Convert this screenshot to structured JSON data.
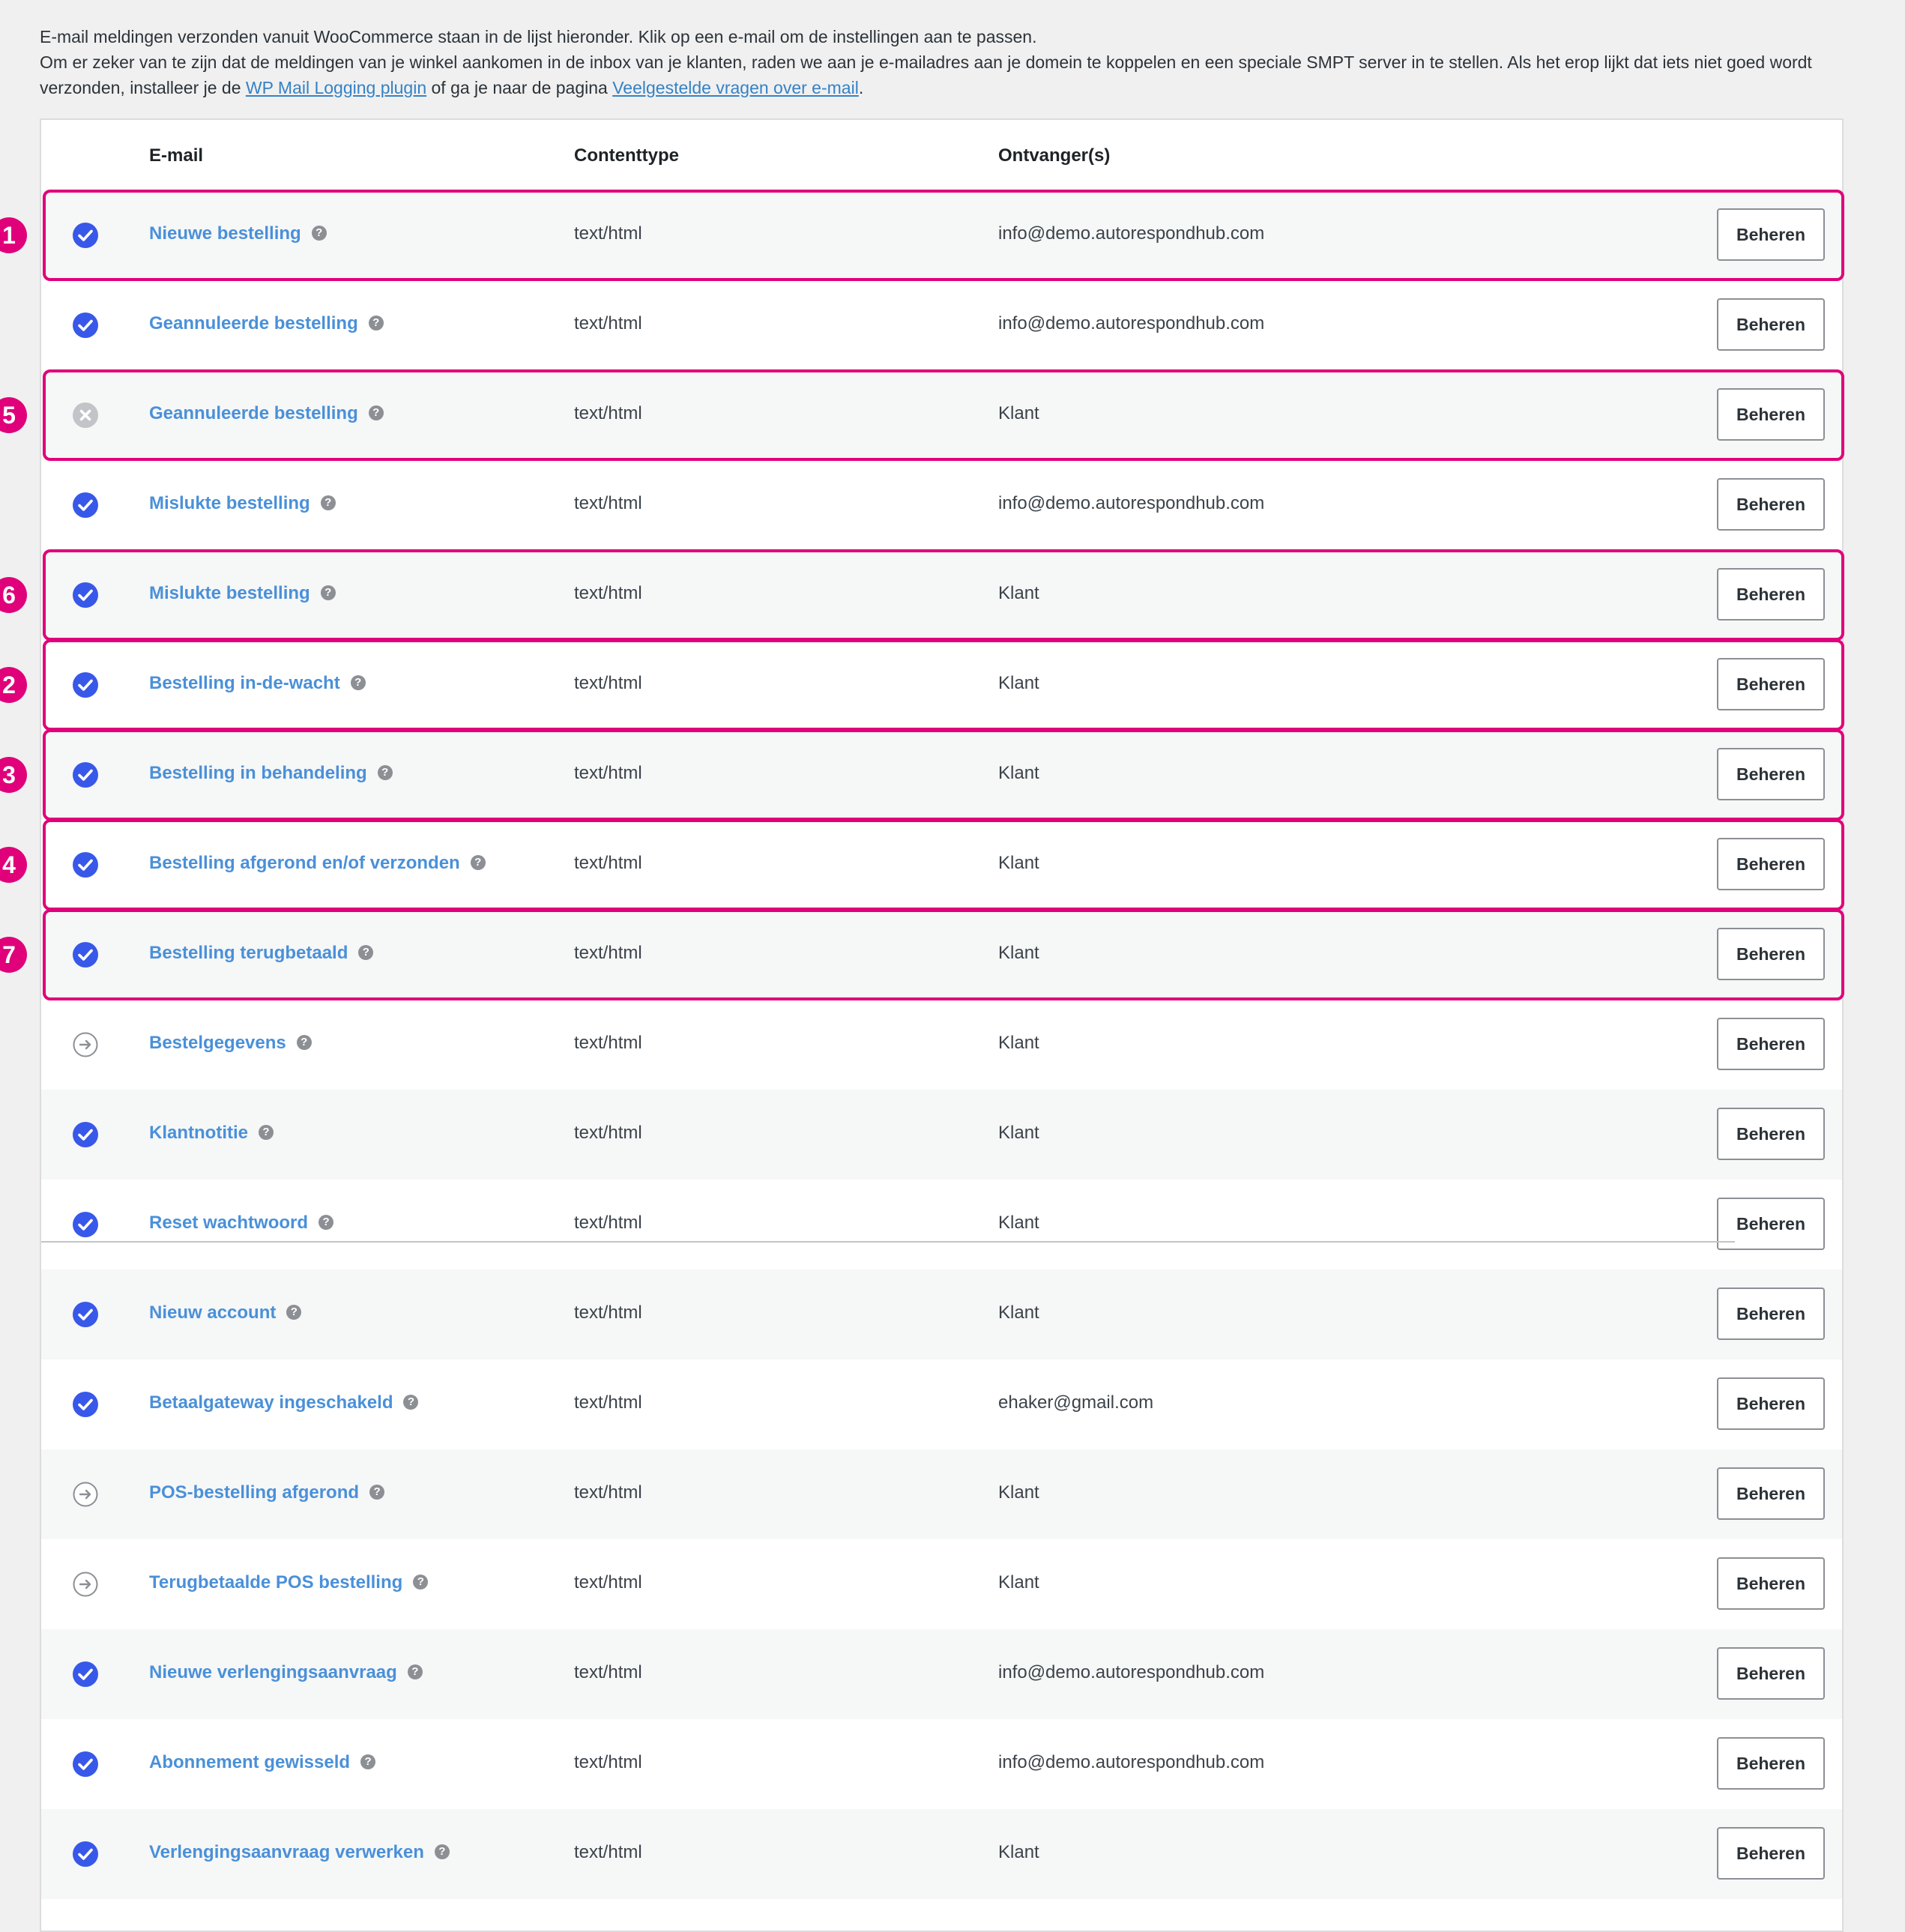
{
  "intro": {
    "line1": "E-mail meldingen verzonden vanuit WooCommerce staan in de lijst hieronder. Klik op een e-mail om de instellingen aan te passen.",
    "line2_pre": "Om er zeker van te zijn dat de meldingen van je winkel aankomen in de inbox van je klanten, raden we aan je e-mailadres aan je domein te koppelen en een speciale SMPT server in te stellen. Als het erop lijkt dat iets niet goed wordt verzonden, installeer je de ",
    "link1": "WP Mail Logging plugin",
    "line2_mid": " of ga je naar de pagina ",
    "link2": "Veelgestelde vragen over e-mail",
    "line2_end": "."
  },
  "table": {
    "headers": {
      "email": "E-mail",
      "content_type": "Contenttype",
      "recipients": "Ontvanger(s)"
    },
    "rows": [
      {
        "status": "enabled",
        "name": "Nieuwe bestelling",
        "content_type": "text/html",
        "recipient": "info@demo.autorespondhub.com",
        "action": "Beheren"
      },
      {
        "status": "enabled",
        "name": "Geannuleerde bestelling",
        "content_type": "text/html",
        "recipient": "info@demo.autorespondhub.com",
        "action": "Beheren"
      },
      {
        "status": "disabled",
        "name": "Geannuleerde bestelling",
        "content_type": "text/html",
        "recipient": "Klant",
        "action": "Beheren"
      },
      {
        "status": "enabled",
        "name": "Mislukte bestelling",
        "content_type": "text/html",
        "recipient": "info@demo.autorespondhub.com",
        "action": "Beheren"
      },
      {
        "status": "enabled",
        "name": "Mislukte bestelling",
        "content_type": "text/html",
        "recipient": "Klant",
        "action": "Beheren"
      },
      {
        "status": "enabled",
        "name": "Bestelling in-de-wacht",
        "content_type": "text/html",
        "recipient": "Klant",
        "action": "Beheren"
      },
      {
        "status": "enabled",
        "name": "Bestelling in behandeling",
        "content_type": "text/html",
        "recipient": "Klant",
        "action": "Beheren"
      },
      {
        "status": "enabled",
        "name": "Bestelling afgerond en/of verzonden",
        "content_type": "text/html",
        "recipient": "Klant",
        "action": "Beheren"
      },
      {
        "status": "enabled",
        "name": "Bestelling terugbetaald",
        "content_type": "text/html",
        "recipient": "Klant",
        "action": "Beheren"
      },
      {
        "status": "manual",
        "name": "Bestelgegevens",
        "content_type": "text/html",
        "recipient": "Klant",
        "action": "Beheren"
      },
      {
        "status": "enabled",
        "name": "Klantnotitie",
        "content_type": "text/html",
        "recipient": "Klant",
        "action": "Beheren"
      },
      {
        "status": "enabled",
        "name": "Reset wachtwoord",
        "content_type": "text/html",
        "recipient": "Klant",
        "action": "Beheren"
      },
      {
        "status": "enabled",
        "name": "Nieuw account",
        "content_type": "text/html",
        "recipient": "Klant",
        "action": "Beheren"
      },
      {
        "status": "enabled",
        "name": "Betaalgateway ingeschakeld",
        "content_type": "text/html",
        "recipient": "ehaker@gmail.com",
        "action": "Beheren"
      },
      {
        "status": "manual",
        "name": "POS-bestelling afgerond",
        "content_type": "text/html",
        "recipient": "Klant",
        "action": "Beheren"
      },
      {
        "status": "manual",
        "name": "Terugbetaalde POS bestelling",
        "content_type": "text/html",
        "recipient": "Klant",
        "action": "Beheren"
      },
      {
        "status": "enabled",
        "name": "Nieuwe verlengingsaanvraag",
        "content_type": "text/html",
        "recipient": "info@demo.autorespondhub.com",
        "action": "Beheren"
      },
      {
        "status": "enabled",
        "name": "Abonnement gewisseld",
        "content_type": "text/html",
        "recipient": "info@demo.autorespondhub.com",
        "action": "Beheren"
      },
      {
        "status": "enabled",
        "name": "Verlengingsaanvraag verwerken",
        "content_type": "text/html",
        "recipient": "Klant",
        "action": "Beheren"
      }
    ]
  },
  "highlights": [
    {
      "row": 0,
      "label": "1"
    },
    {
      "row": 2,
      "label": "5"
    },
    {
      "row": 4,
      "label": "6"
    },
    {
      "row": 5,
      "label": "2"
    },
    {
      "row": 6,
      "label": "3"
    },
    {
      "row": 7,
      "label": "4"
    },
    {
      "row": 8,
      "label": "7"
    }
  ],
  "help_glyph": "?",
  "colors": {
    "accent": "#3858e9",
    "link": "#4a90d9",
    "highlight": "#e0007a",
    "disabled": "#c3c4c7",
    "manual": "#8c8f94"
  }
}
